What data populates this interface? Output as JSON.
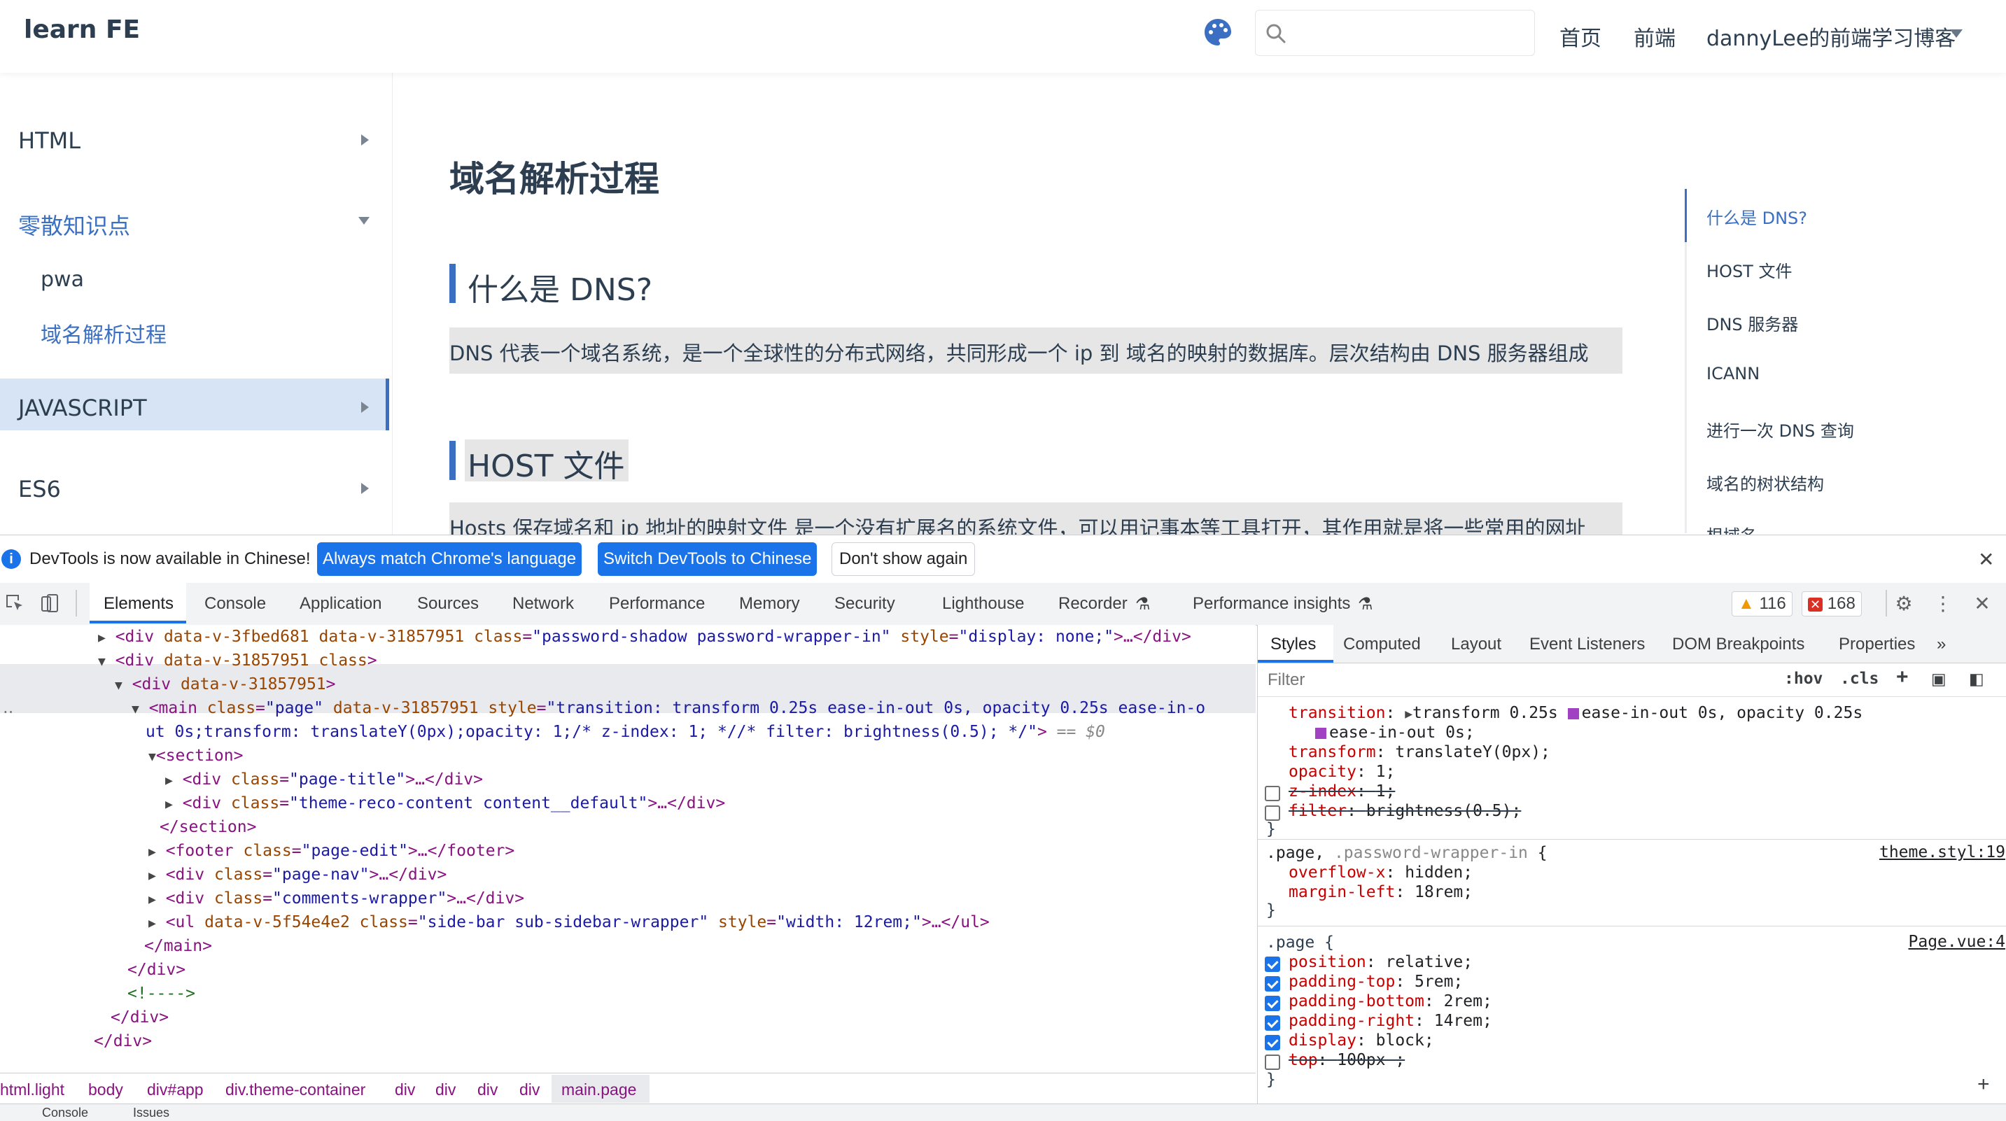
{
  "navbar": {
    "title": "learn FE",
    "search_placeholder": "",
    "links": [
      "首页",
      "前端",
      "dannyLee的前端学习博客"
    ]
  },
  "sidebar": {
    "groups": [
      {
        "label": "HTML",
        "expanded": false
      },
      {
        "label": "零散知识点",
        "expanded": true,
        "items": [
          "pwa",
          "域名解析过程"
        ],
        "active_item": "域名解析过程"
      },
      {
        "label": "JAVASCRIPT",
        "expanded": false
      },
      {
        "label": "ES6",
        "expanded": false
      }
    ]
  },
  "content": {
    "title": "域名解析过程",
    "sections": [
      {
        "heading": "什么是 DNS?",
        "paragraph": "DNS 代表一个域名系统，是一个全球性的分布式网络，共同形成一个 ip 到 域名的映射的数据库。层次结构由 DNS 服务器组成"
      },
      {
        "heading": "HOST 文件",
        "paragraph": "Hosts 保存域名和 ip 地址的映射文件 是一个没有扩展名的系统文件，可以用记事本等工具打开，其作用就是将一些常用的网址"
      }
    ]
  },
  "toc": {
    "items": [
      "什么是 DNS?",
      "HOST 文件",
      "DNS 服务器",
      "ICANN",
      "进行一次 DNS 查询",
      "域名的树状结构",
      "根域名"
    ],
    "active": "什么是 DNS?"
  },
  "devtools": {
    "infobar": {
      "message": "DevTools is now available in Chinese!",
      "btn_match": "Always match Chrome's language",
      "btn_switch": "Switch DevTools to Chinese",
      "btn_dont": "Don't show again"
    },
    "tabs": [
      "Elements",
      "Console",
      "Application",
      "Sources",
      "Network",
      "Performance",
      "Memory",
      "Security",
      "Lighthouse",
      "Recorder",
      "Performance insights"
    ],
    "active_tab": "Elements",
    "warnings": "116",
    "errors": "168",
    "dom_lines": {
      "l1": {
        "tag": "<div",
        "a1": " data-v-3fbed681 data-v-31857951 ",
        "an": "class",
        "av": "\"password-shadow password-wrapper-in\"",
        "an2": " style",
        "av2": "\"display: none;\"",
        "rest": ">…</div>"
      },
      "l2": {
        "tag": "<div",
        "a1": " data-v-31857951 class",
        "rest": ">"
      },
      "l3": {
        "tag": "<div",
        "a1": " data-v-31857951",
        "rest": ">"
      },
      "l4a": {
        "tag": "<main",
        "an": " class",
        "av": "\"page\"",
        "an2": " data-v-31857951 style",
        "av2": "\"transition: transform 0.25s ease-in-out 0s, opacity 0.25s ease-in-o"
      },
      "l4b": {
        "av": "ut 0s;transform: translateY(0px);opacity: 1;/* z-index: 1; *//* filter: brightness(0.5); */\"",
        "rest": ">",
        "eq": " == $0"
      },
      "l5": "<section>",
      "l6": {
        "tag": "<div",
        "an": " class",
        "av": "\"page-title\"",
        "rest": ">…</div>"
      },
      "l7": {
        "tag": "<div",
        "an": " class",
        "av": "\"theme-reco-content content__default\"",
        "rest": ">…</div>"
      },
      "l8": "</section>",
      "l9": {
        "tag": "<footer",
        "an": " class",
        "av": "\"page-edit\"",
        "rest": ">…</footer>"
      },
      "l10": {
        "tag": "<div",
        "an": " class",
        "av": "\"page-nav\"",
        "rest": ">…</div>"
      },
      "l11": {
        "tag": "<div",
        "an": " class",
        "av": "\"comments-wrapper\"",
        "rest": ">…</div>"
      },
      "l12": {
        "tag": "<ul",
        "an": " data-v-5f54e4e2 class",
        "av": "\"side-bar sub-sidebar-wrapper\"",
        "an2": " style",
        "av2": "\"width: 12rem;\"",
        "rest": ">…</ul>"
      },
      "l13": "</main>",
      "l14": "</div>",
      "l15": "<!---->",
      "l16": "</div>",
      "l17": "</div>"
    },
    "breadcrumbs": [
      "html.light",
      "body",
      "div#app",
      "div.theme-container",
      "div",
      "div",
      "div",
      "div",
      "main.page"
    ],
    "styles_tabs": [
      "Styles",
      "Computed",
      "Layout",
      "Event Listeners",
      "DOM Breakpoints",
      "Properties"
    ],
    "filter_placeholder": "Filter",
    "filter_hov": ":hov",
    "filter_cls": ".cls",
    "style_lines": {
      "s1_prop": "transition",
      "s1_val_a": "transform 0.25s ",
      "s1_val_b": "ease-in-out 0s, opacity 0.25s",
      "s1_val_c": "ease-in-out 0s;",
      "s2_prop": "transform",
      "s2_val": "translateY(0px);",
      "s3_prop": "opacity",
      "s3_val": "1;",
      "s4_prop": "z-index",
      "s4_val": "1;",
      "s5_prop": "filter",
      "s5_val": "brightness(0.5);",
      "close": "}",
      "r2_sel_a": ".page,",
      "r2_sel_b": " .password-wrapper-in",
      "r2_open": " {",
      "r2_src": "theme.styl:19",
      "r2_p1": "overflow-x",
      "r2_v1": "hidden;",
      "r2_p2": "margin-left",
      "r2_v2": "18rem;",
      "r3_sel": ".page {",
      "r3_src": "Page.vue:4",
      "r3_p1": "position",
      "r3_v1": "relative;",
      "r3_p2": "padding-top",
      "r3_v2": "5rem;",
      "r3_p3": "padding-bottom",
      "r3_v3": "2rem;",
      "r3_p4": "padding-right",
      "r3_v4": "14rem;",
      "r3_p5": "display",
      "r3_v5": "block;",
      "r3_p6": "top",
      "r3_v6": "100px ;"
    },
    "drawer_tabs": [
      "Console",
      "Issues"
    ]
  }
}
